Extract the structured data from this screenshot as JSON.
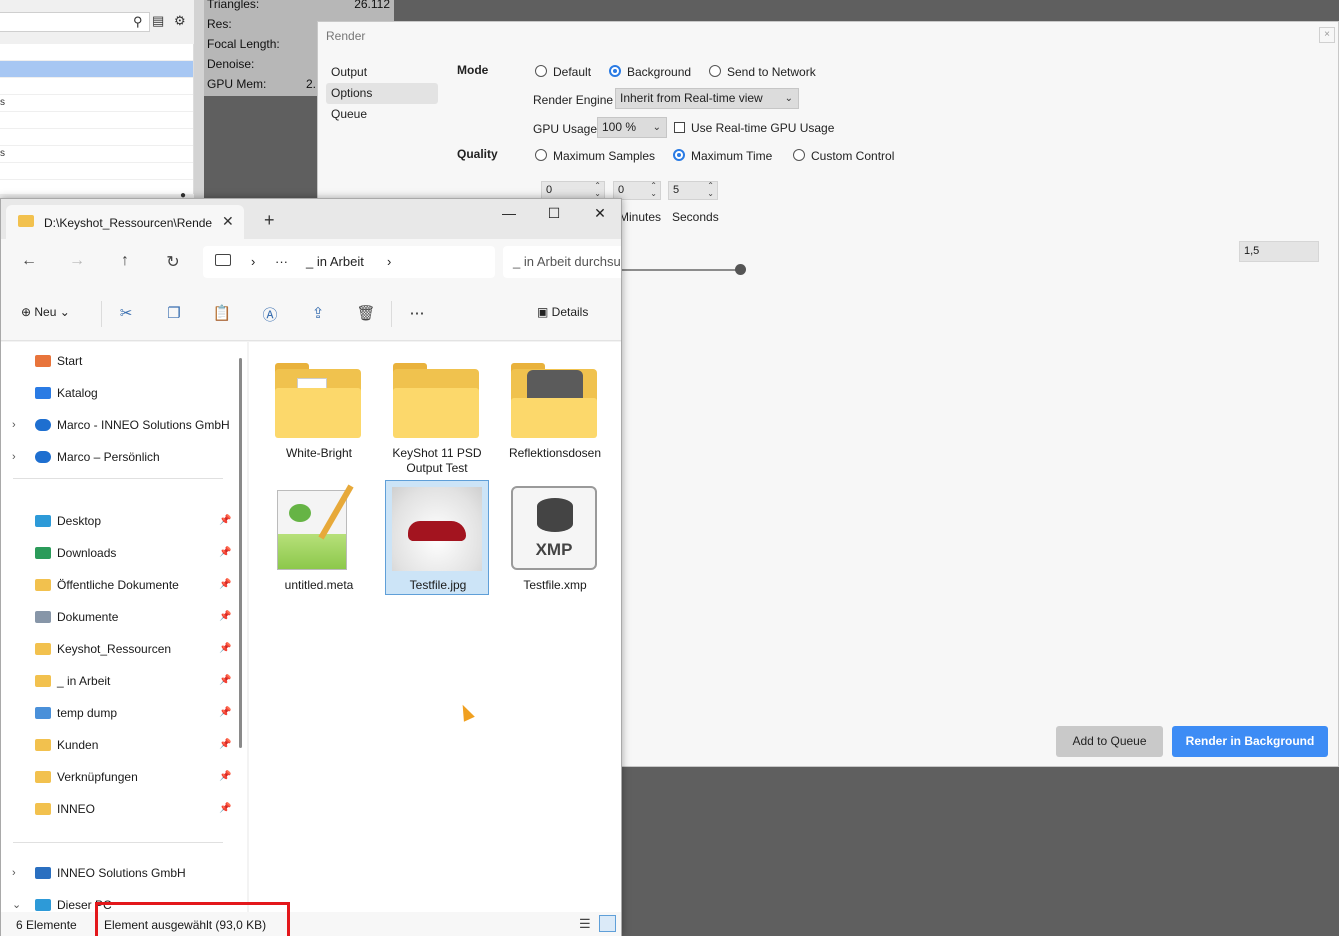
{
  "stats": {
    "triangles_label": "Triangles:",
    "triangles_value": "26.112",
    "res_label": "Res:",
    "res_value": "",
    "focal_label": "Focal Length:",
    "focal_value": "",
    "denoise_label": "Denoise:",
    "denoise_value": "",
    "gpu_label": "GPU Mem:",
    "gpu_value": "2..."
  },
  "scene_tree": {
    "rows": [
      "",
      "",
      "",
      "s",
      "",
      "",
      "s",
      "",
      ""
    ]
  },
  "render": {
    "title": "Render",
    "close": "×",
    "nav": [
      "Output",
      "Options",
      "Queue"
    ],
    "mode_label": "Mode",
    "mode_options": [
      "Default",
      "Background",
      "Send to Network"
    ],
    "engine_label": "Render Engine",
    "engine_value": "Inherit from Real-time view",
    "gpu_usage_label": "GPU Usage",
    "gpu_usage_value": "100 %",
    "realtime_gpu_label": "Use Real-time GPU Usage",
    "quality_label": "Quality",
    "quality_options": [
      "Maximum Samples",
      "Maximum Time",
      "Custom Control"
    ],
    "time_values": [
      "0",
      "0",
      "5"
    ],
    "time_units": [
      "Minutes",
      "Seconds"
    ],
    "slider_value": "1,5",
    "add_to_queue": "Add to Queue",
    "render_background": "Render in Background"
  },
  "explorer": {
    "tab_title": "D:\\Keyshot_Ressourcen\\Rende",
    "tab_close": "✕",
    "new_tab": "+",
    "minimize": "—",
    "maximize": "☐",
    "close": "✕",
    "breadcrumb_more": "···",
    "breadcrumb_current": "_ in Arbeit",
    "search_placeholder": "_ in Arbeit durchsu",
    "cmd_new": "Neu",
    "cmd_details": "Details",
    "nav_items": [
      {
        "label": "Start",
        "icon": "home-icon",
        "color": "#e8743b"
      },
      {
        "label": "Katalog",
        "icon": "gallery-icon",
        "color": "#2a7be4"
      },
      {
        "label": "Marco - INNEO Solutions GmbH",
        "icon": "onedrive-icon",
        "color": "#1e6fd0"
      },
      {
        "label": "Marco – Persönlich",
        "icon": "onedrive-icon",
        "color": "#1e6fd0"
      },
      {
        "label": "Desktop",
        "icon": "desktop-icon",
        "color": "#2d9ad8"
      },
      {
        "label": "Downloads",
        "icon": "download-icon",
        "color": "#2b9b5a"
      },
      {
        "label": "Öffentliche Dokumente",
        "icon": "folder-icon",
        "color": "#f2c14e"
      },
      {
        "label": "Dokumente",
        "icon": "document-icon",
        "color": "#8796a8"
      },
      {
        "label": "Keyshot_Ressourcen",
        "icon": "folder-icon",
        "color": "#f2c14e"
      },
      {
        "label": "_ in Arbeit",
        "icon": "folder-icon",
        "color": "#f2c14e"
      },
      {
        "label": "temp dump",
        "icon": "sync-folder-icon",
        "color": "#4a90d9"
      },
      {
        "label": "Kunden",
        "icon": "folder-icon",
        "color": "#f2c14e"
      },
      {
        "label": "Verknüpfungen",
        "icon": "folder-icon",
        "color": "#f2c14e"
      },
      {
        "label": "INNEO",
        "icon": "folder-icon",
        "color": "#f2c14e"
      },
      {
        "label": "INNEO Solutions GmbH",
        "icon": "building-icon",
        "color": "#2a6fc0"
      },
      {
        "label": "Dieser PC",
        "icon": "pc-icon",
        "color": "#2d9ad8"
      }
    ],
    "files": [
      {
        "name": "White-Bright",
        "type": "folder"
      },
      {
        "name": "KeyShot 11 PSD Output Test",
        "type": "folder"
      },
      {
        "name": "Reflektionsdosen",
        "type": "folder"
      },
      {
        "name": "untitled.meta",
        "type": "notepad"
      },
      {
        "name": "Testfile.jpg",
        "type": "image"
      },
      {
        "name": "Testfile.xmp",
        "type": "xmp"
      }
    ],
    "xmp_label": "XMP",
    "status_count": "6 Elemente",
    "status_selected": "Element ausgewählt (93,0 KB)"
  }
}
